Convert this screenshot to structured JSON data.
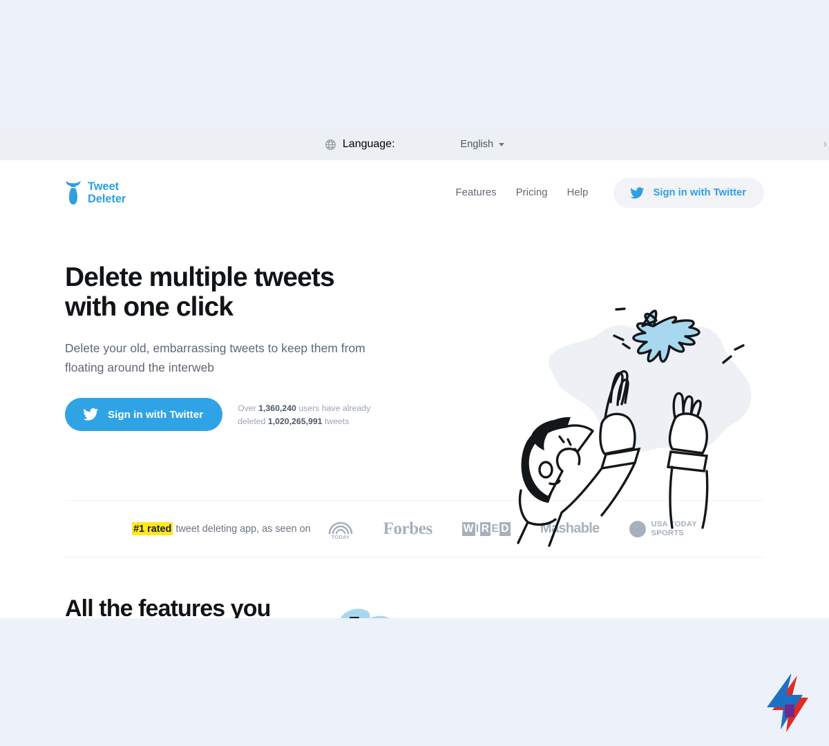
{
  "language_bar": {
    "globe_icon": "globe-icon",
    "label": "Language:",
    "selected": "English",
    "caret_icon": "chevron-down-icon",
    "edge_chevron": "›"
  },
  "header": {
    "logo": {
      "icon": "bomb-icon",
      "line1": "Tweet",
      "line2": "Deleter"
    },
    "nav": [
      {
        "label": "Features"
      },
      {
        "label": "Pricing"
      },
      {
        "label": "Help"
      }
    ],
    "cta": {
      "icon": "twitter-bird-icon",
      "label": "Sign in with Twitter"
    }
  },
  "hero": {
    "title": "Delete multiple tweets with one click",
    "subtitle": "Delete your old, embarrassing tweets to keep them from floating around the interweb",
    "cta": {
      "icon": "twitter-bird-icon",
      "label": "Sign in with Twitter"
    },
    "stats": {
      "prefix": "Over",
      "users": "1,360,240",
      "middle": "users have already deleted",
      "tweets": "1,020,265,991",
      "suffix": "tweets"
    },
    "illustration": "person-releasing-bird-illustration"
  },
  "press": {
    "claim_highlight": "#1 rated",
    "claim_rest": "tweet deleting app, as seen on",
    "logos": [
      {
        "name": "today-logo",
        "text": "TODAY"
      },
      {
        "name": "forbes-logo",
        "text": "Forbes"
      },
      {
        "name": "wired-logo",
        "letters": [
          "W",
          "I",
          "R",
          "E",
          "D"
        ],
        "boxed": [
          true,
          false,
          true,
          false,
          true
        ]
      },
      {
        "name": "mashable-logo",
        "text": "Mashable"
      },
      {
        "name": "usa-today-sports-logo",
        "line1": "USA TODAY",
        "line2": "SPORTS"
      }
    ]
  },
  "features": {
    "title": "All the features you",
    "icons": [
      {
        "name": "cloud-icon"
      },
      {
        "name": "glasses-icon"
      }
    ]
  },
  "corner": {
    "logo": "lightning-bolt-logo"
  },
  "colors": {
    "page_background": "#edf1fa",
    "language_bar": "#eceff3",
    "twitter_blue": "#30a3e6",
    "logo_blue": "#2e9fe0",
    "highlight_yellow": "#ffe81f",
    "heading_black": "#111417",
    "body_gray": "#5d6875",
    "press_gray": "#a7b0bd",
    "bird_light_blue": "#a8d8f0",
    "bolt_blue": "#1f6fc4",
    "bolt_red": "#e02b20",
    "bolt_purple": "#6b2a8e"
  }
}
